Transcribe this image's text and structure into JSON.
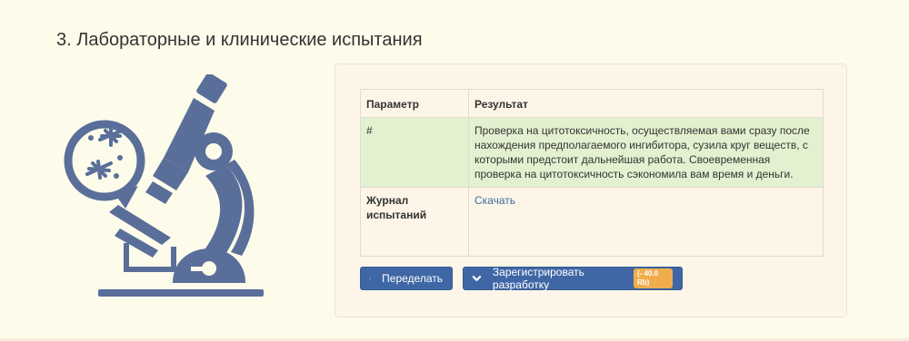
{
  "section": {
    "title": "3. Лабораторные и клинические испытания"
  },
  "illustration": {
    "icon": "microscope-icon",
    "color": "#5a6e9a"
  },
  "table": {
    "headers": {
      "param": "Параметр",
      "result": "Результат"
    },
    "result_row": {
      "param": "#",
      "text": "Проверка на цитотоксичность, осуществляемая вами сразу после нахождения предполагаемого ингибитора, сузила круг веществ, с которыми предстоит дальнейшая работа. Своевременная проверка на цитотоксичность сэкономила вам время и деньги."
    },
    "journal_row": {
      "param": "Журнал испытаний",
      "link": "Скачать"
    }
  },
  "buttons": {
    "redo": {
      "label": "Переделать",
      "icon": "chevron-up-icon"
    },
    "register": {
      "label": "Зарегистрировать разработку",
      "badge": "(- 40.0 Rb)",
      "icon": "chevron-down-icon"
    }
  },
  "colors": {
    "button": "#3f67a5",
    "success_row": "#e3f1d0",
    "badge": "#f0ad4e",
    "page_bg": "#fdfbea"
  }
}
